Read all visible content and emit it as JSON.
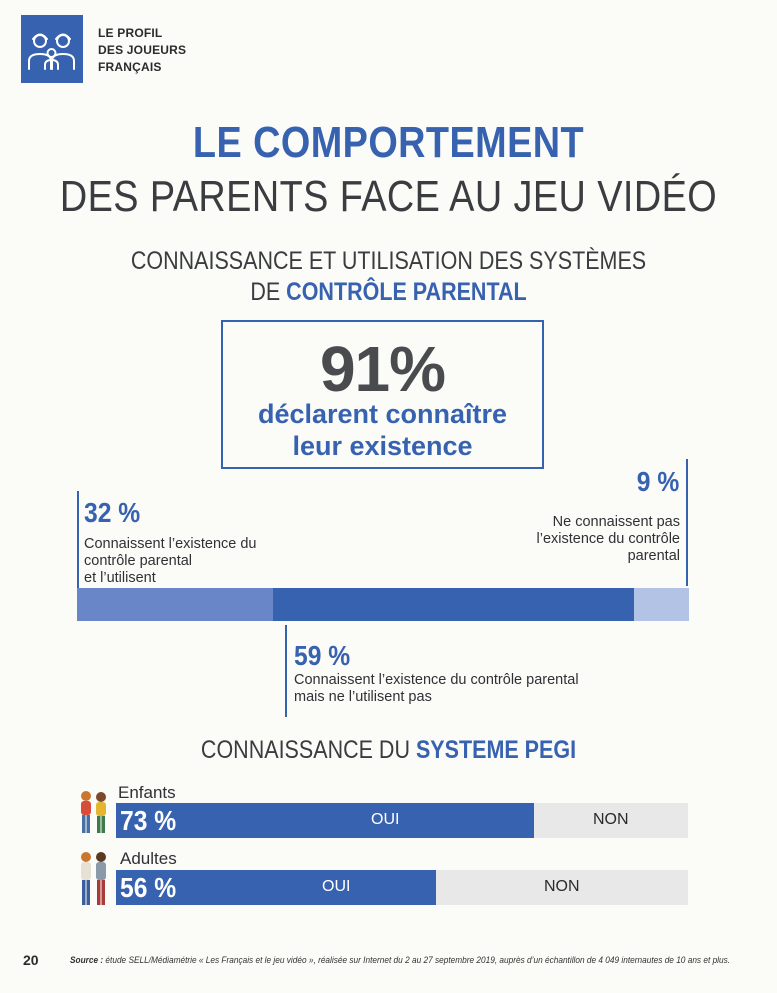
{
  "header": {
    "section_lines": [
      "LE PROFIL",
      "DES JOUEURS",
      "FRANÇAIS"
    ],
    "icon": "family-icon"
  },
  "title": {
    "line1": "LE COMPORTEMENT",
    "line2": "DES PARENTS FACE AU JEU VIDÉO"
  },
  "parental_control": {
    "heading_line1": "CONNAISSANCE ET UTILISATION DES SYSTÈMES",
    "heading_line2_prefix": "DE ",
    "heading_line2_highlight": "CONTRÔLE PARENTAL",
    "headline_pct": "91%",
    "headline_desc_line1": "déclarent connaître",
    "headline_desc_line2": "leur existence",
    "segments": [
      {
        "pct_label": "32 %",
        "value": 32,
        "desc_lines": [
          "Connaissent l’existence du",
          "contrôle parental",
          "et l’utilisent"
        ],
        "color": "#6886c8"
      },
      {
        "pct_label": "59 %",
        "value": 59,
        "desc_lines": [
          "Connaissent l’existence du contrôle parental",
          "mais ne l’utilisent pas"
        ],
        "color": "#3762b0"
      },
      {
        "pct_label": "9 %",
        "value": 9,
        "desc_lines": [
          "Ne connaissent pas",
          "l’existence du contrôle",
          "parental"
        ],
        "color": "#b3c3e6"
      }
    ]
  },
  "pegi": {
    "heading_prefix": "CONNAISSANCE DU ",
    "heading_highlight": "SYSTEME PEGI",
    "rows": [
      {
        "label": "Enfants",
        "pct_label": "73 %",
        "value": 73,
        "yes_label": "OUI",
        "no_label": "NON",
        "icon": "children-icon"
      },
      {
        "label": "Adultes",
        "pct_label": "56 %",
        "value": 56,
        "yes_label": "OUI",
        "no_label": "NON",
        "icon": "adults-icon"
      }
    ]
  },
  "footer": {
    "page_number": "20",
    "source_label": "Source :",
    "source_text": " étude SELL/Médiamétrie « Les Français et le jeu vidéo », réalisée sur Internet du 2 au 27 septembre 2019, auprès d’un échantillon de 4 049 internautes de 10 ans et plus."
  },
  "colors": {
    "brand_blue": "#3762b0",
    "light_blue": "#6886c8",
    "pale_blue": "#b3c3e6",
    "track_grey": "#e8e8e8"
  }
}
